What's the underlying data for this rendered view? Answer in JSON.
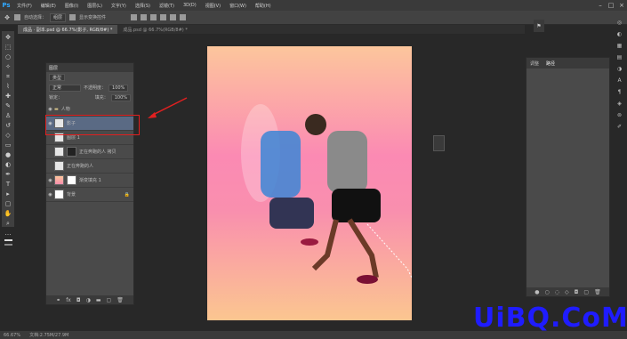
{
  "app": {
    "logo": "Ps"
  },
  "menu": [
    "文件(F)",
    "编辑(E)",
    "图像(I)",
    "图层(L)",
    "文字(Y)",
    "选择(S)",
    "滤镜(T)",
    "3D(D)",
    "视图(V)",
    "窗口(W)",
    "帮助(H)"
  ],
  "options": {
    "auto_select": "自动选择：",
    "group": "组层",
    "show_transform": "显示变换控件"
  },
  "tabs": [
    "成品 · 副本.psd @ 66.7%(影子, RGB/8#) *",
    "成品.psd @ 66.7%(RGB/8#) *"
  ],
  "layers_panel": {
    "title": "图层",
    "kind": "类型",
    "blend": "正常",
    "opacity_label": "不透明度：",
    "opacity": "100%",
    "lock_label": "锁定：",
    "fill_label": "填充：",
    "fill": "100%",
    "layers": [
      {
        "name": "人物"
      },
      {
        "name": "影子"
      },
      {
        "name": "图层 1"
      },
      {
        "name": "正在奔跑的人 拷贝"
      },
      {
        "name": "正在奔跑的人"
      },
      {
        "name": "渐变填充 1"
      },
      {
        "name": "背景"
      }
    ]
  },
  "right_panel": {
    "tab1": "调整",
    "tab2": "路径"
  },
  "status": {
    "zoom": "66.67%",
    "doc": "文档:2.75M/27.9M"
  },
  "watermark": "UiBQ.CoM"
}
